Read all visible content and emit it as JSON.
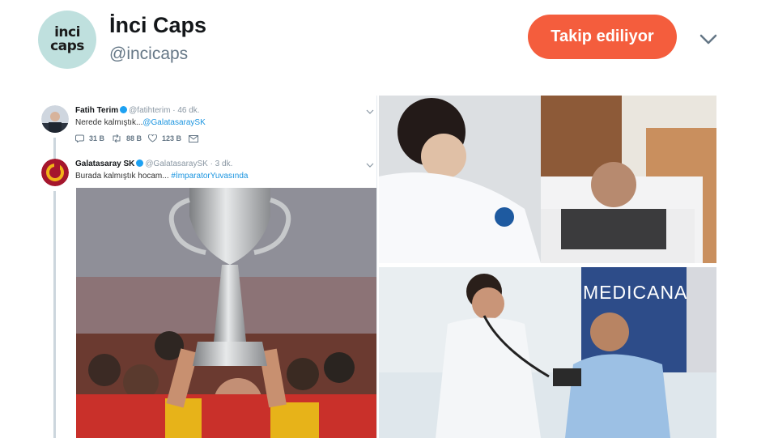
{
  "profile": {
    "name": "İnci Caps",
    "handle": "@incicaps",
    "avatar_logo_lines": [
      "inci",
      "caps"
    ],
    "follow_label": "Takip ediliyor"
  },
  "colors": {
    "follow_button": "#f45d3d",
    "avatar_bg": "#bfe0de",
    "link": "#1b95e0",
    "secondary_text": "#657786"
  },
  "embedded_tweets": [
    {
      "name": "Fatih Terim",
      "meta": "@fatihterim · 46 dk.",
      "text_plain": "Nerede kalmıştık...",
      "text_link": "@GalatasaraySK",
      "replies": "31 B",
      "retweets": "88 B",
      "likes": "123 B"
    },
    {
      "name": "Galatasaray SK",
      "meta": "@GalatasaraySK · 3 dk.",
      "text_plain": "Burada kalmıştık hocam... ",
      "text_link": "#İmparatorYuvasında"
    }
  ],
  "photo_texts": {
    "clinic_sign": "MEDICANA"
  },
  "icons": {
    "menu": "chevron-down-icon",
    "reply": "reply-icon",
    "retweet": "retweet-icon",
    "like": "heart-icon",
    "dm": "envelope-icon"
  }
}
